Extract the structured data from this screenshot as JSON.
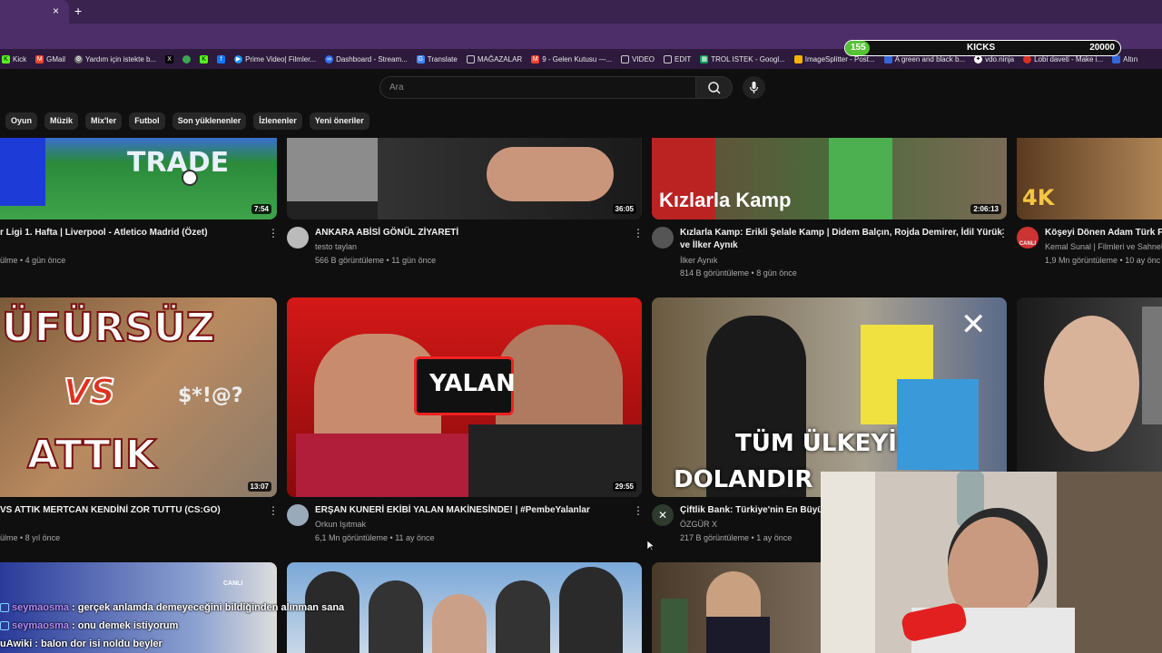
{
  "browser": {
    "new_tab": "+",
    "close": "×",
    "bookmarks": [
      "Kick",
      "GMail",
      "Yardım için istekte b...",
      "",
      "",
      "",
      "",
      "Prime Video| Filmler...",
      "Dashboard - Stream...",
      "Translate",
      "MAĞAZALAR",
      "9 - Gelen Kutusu —...",
      "VIDEO",
      "EDIT",
      "TROL ISTEK - Googl...",
      "ImageSplitter - Post...",
      "A green and black b...",
      "vdo.ninja",
      "Lobi daveti - Make i...",
      "Altın"
    ]
  },
  "kicks": {
    "current": "155",
    "label": "KICKS",
    "goal": "20000",
    "progress": 0.0078
  },
  "search": {
    "placeholder": "Ara"
  },
  "chips": [
    "Oyun",
    "Müzik",
    "Mix'ler",
    "Futbol",
    "Son yüklenenler",
    "İzlenenler",
    "Yeni öneriler"
  ],
  "videos": {
    "v1": {
      "title": "r Ligi 1. Hafta | Liverpool - Atletico Madrid (Özet)",
      "meta": "ülme • 4 gün önce",
      "duration": "7:54"
    },
    "v2": {
      "title": "ANKARA ABİSİ GÖNÜL ZİYARETİ",
      "channel": "testo taylan",
      "meta": "566 B görüntüleme • 11 gün önce",
      "duration": "36:05"
    },
    "v3": {
      "title": "Kızlarla Kamp: Erikli Şelale Kamp | Didem Balçın, Rojda Demirer, İdil Yürük",
      "title2": "ve İlker Aynık",
      "channel": "İlker Aynık",
      "meta": "814 B görüntüleme • 8 gün önce",
      "duration": "2:06:13",
      "thumb_text": "Kızlarla Kamp"
    },
    "v4": {
      "title": "Köşeyi Dönen Adam Türk Fil",
      "channel": "Kemal Sunal | Filmleri ve Sahnel",
      "meta": "1,9 Mn görüntüleme • 10 ay önc",
      "thumb_text": "4K",
      "live": "CANLI"
    },
    "v5": {
      "title": "VS ATTIK MERTCAN KENDİNİ ZOR TUTTU (CS:GO)",
      "meta": "ülme • 8 yıl önce",
      "duration": "13:07",
      "t1": "ÜFÜRSÜZ",
      "t2": "VS",
      "t3": "$*!@?",
      "t4": "ATTIK"
    },
    "v6": {
      "title": "ERŞAN KUNERİ EKİBİ YALAN MAKİNESİNDE! | #PembeYalanlar",
      "channel": "Orkun Işıtmak",
      "meta": "6,1 Mn görüntüleme • 11 ay önce",
      "duration": "29:55",
      "thumb_text": "YALAN"
    },
    "v7": {
      "title": "Çiftlik Bank: Türkiye'nin En Büyük",
      "channel": "ÖZGÜR X",
      "meta": "217 B görüntüleme • 1 ay önce",
      "t1": "TÜM ÜLKEYİ",
      "t2": "DOLANDIR"
    },
    "v9": {
      "live": "CANLI"
    }
  },
  "chat": [
    {
      "user": "seymaosma",
      "text": ": gerçek anlamda demeyeceğini bildiğinden alınman sana"
    },
    {
      "user": "seymaosma",
      "text": ": onu demek istiyorum"
    },
    {
      "user": "uAwiki",
      "text": ": balon dor isi noldu beyler"
    }
  ],
  "colors": {
    "accent": "#55c434",
    "chat_user": "#b38cff",
    "bg": "#0f0f0f"
  }
}
